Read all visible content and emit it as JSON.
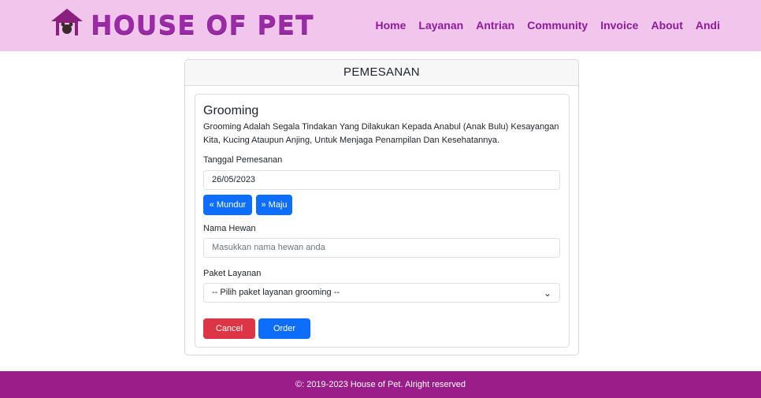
{
  "brand": {
    "name": "HOUSE OF PET",
    "logo_icon": "house-paw-icon"
  },
  "nav": {
    "items": [
      {
        "label": "Home"
      },
      {
        "label": "Layanan"
      },
      {
        "label": "Antrian"
      },
      {
        "label": "Community"
      },
      {
        "label": "Invoice"
      },
      {
        "label": "About"
      },
      {
        "label": "Andi"
      }
    ]
  },
  "card": {
    "header": "PEMESANAN",
    "service_title": "Grooming",
    "description": "Grooming Adalah Segala Tindakan Yang Dilakukan Kepada Anabul (Anak Bulu) Kesayangan Kita, Kucing Ataupun Anjing, Untuk Menjaga Penampilan Dan Kesehatannya.",
    "date_label": "Tanggal Pemesanan",
    "date_value": "26/05/2023",
    "back_button": "« Mundur",
    "forward_button": "» Maju",
    "pet_label": "Nama Hewan",
    "pet_placeholder": "Masukkan nama hewan anda",
    "package_label": "Paket Layanan",
    "package_selected": "-- Pilih paket layanan grooming --",
    "cancel_button": "Cancel",
    "order_button": "Order"
  },
  "footer": {
    "text": "©: 2019-2023 House of Pet. Alright reserved"
  },
  "colors": {
    "navbar": "#f2c5ec",
    "brand": "#9b2aa6",
    "primary": "#0d6efd",
    "danger": "#dc3545",
    "footer": "#9a1d8a"
  }
}
